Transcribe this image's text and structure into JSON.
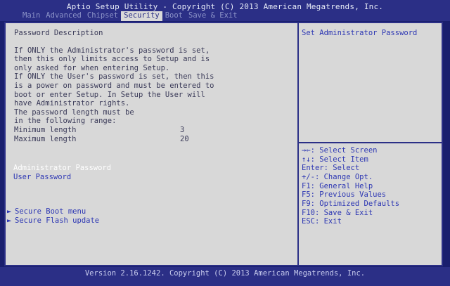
{
  "header": {
    "title": "Aptio Setup Utility - Copyright (C) 2013 American Megatrends, Inc.",
    "tabs": [
      {
        "label": "Main",
        "active": false
      },
      {
        "label": "Advanced",
        "active": false
      },
      {
        "label": "Chipset",
        "active": false
      },
      {
        "label": "Security",
        "active": true
      },
      {
        "label": "Boot",
        "active": false
      },
      {
        "label": "Save & Exit",
        "active": false
      }
    ]
  },
  "main": {
    "heading": "Password Description",
    "description": [
      "If ONLY the Administrator's password is set,",
      "then this only limits access to Setup and is",
      "only asked for when entering Setup.",
      "If ONLY the User's password is set, then this",
      "is a power on password and must be entered to",
      "boot or enter Setup. In Setup the User will",
      "have Administrator rights.",
      "The password length must be",
      "in the following range:"
    ],
    "min_label": "Minimum length",
    "min_value": "3",
    "max_label": "Maximum length",
    "max_value": "20",
    "admin_password": "Administrator Password",
    "user_password": "User Password",
    "secure_boot": "Secure Boot menu",
    "secure_flash": "Secure Flash update",
    "arrow": "►"
  },
  "help": {
    "text": "Set Administrator Password",
    "keys": [
      "→←: Select Screen",
      "↑↓: Select Item",
      "Enter: Select",
      "+/-: Change Opt.",
      "F1: General Help",
      "F5: Previous Values",
      "F9: Optimized Defaults",
      "F10: Save & Exit",
      "ESC: Exit"
    ]
  },
  "footer": {
    "text": "Version 2.16.1242. Copyright (C) 2013 American Megatrends, Inc."
  },
  "colors": {
    "background": "#1a1f6e",
    "bar": "#2b2f86",
    "panel": "#d8d8d8",
    "item_blue": "#2d37b3",
    "selected": "#ffffff"
  }
}
